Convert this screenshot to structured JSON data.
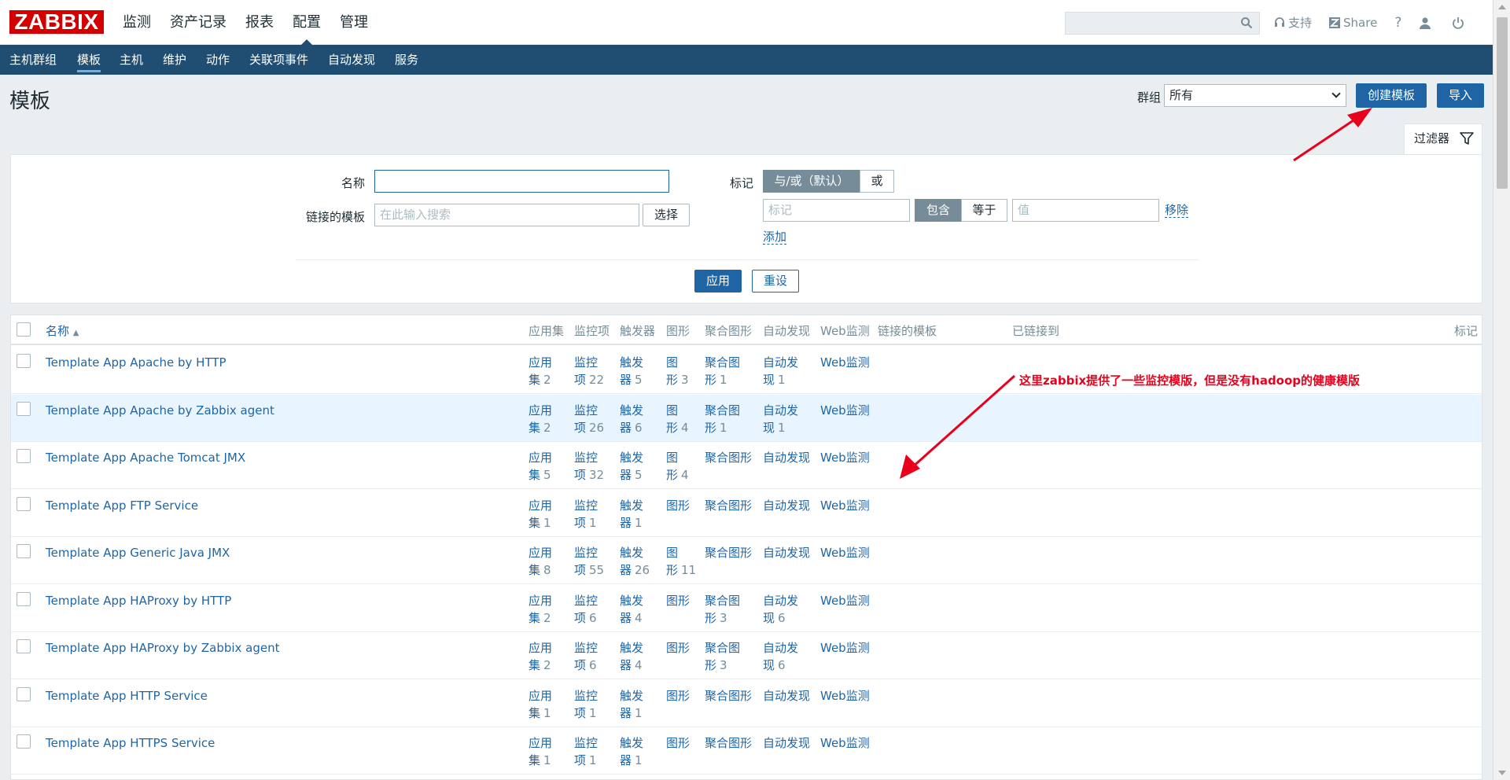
{
  "brand": {
    "logo_text": "ZABBIX",
    "accent": "#d40000",
    "nav_bg": "#1f4e72",
    "link": "#1f65a6"
  },
  "top_menu": [
    {
      "label": "监测",
      "active": false
    },
    {
      "label": "资产记录",
      "active": false
    },
    {
      "label": "报表",
      "active": false
    },
    {
      "label": "配置",
      "active": true
    },
    {
      "label": "管理",
      "active": false
    }
  ],
  "search": {
    "placeholder": "",
    "icon": "search-icon"
  },
  "top_links": {
    "support": "支持",
    "share": "Share",
    "help": "?",
    "user_icon": "user-icon",
    "logout_icon": "power-icon"
  },
  "sub_menu": [
    {
      "label": "主机群组",
      "active": false
    },
    {
      "label": "模板",
      "active": true
    },
    {
      "label": "主机",
      "active": false
    },
    {
      "label": "维护",
      "active": false
    },
    {
      "label": "动作",
      "active": false
    },
    {
      "label": "关联项事件",
      "active": false
    },
    {
      "label": "自动发现",
      "active": false
    },
    {
      "label": "服务",
      "active": false
    }
  ],
  "page": {
    "title": "模板",
    "group_label": "群组",
    "group_value": "所有",
    "create_button": "创建模板",
    "import_button": "导入",
    "filter_tab": "过滤器"
  },
  "filter": {
    "name_label": "名称",
    "name_value": "",
    "linked_label": "链接的模板",
    "linked_placeholder": "在此输入搜索",
    "select_button": "选择",
    "tags_label": "标记",
    "tag_mode_and": "与/或（默认）",
    "tag_mode_or": "或",
    "tag_placeholder": "标记",
    "op_contains": "包含",
    "op_equals": "等于",
    "value_placeholder": "值",
    "remove_link": "移除",
    "add_link": "添加",
    "apply_button": "应用",
    "reset_button": "重设"
  },
  "table": {
    "headers": {
      "name": "名称",
      "sort_arrow": "▲",
      "apps": "应用集",
      "items": "监控项",
      "triggers": "触发器",
      "graphs": "图形",
      "screens": "聚合图形",
      "discovery": "自动发现",
      "web": "Web监测",
      "linked_templates": "链接的模板",
      "linked_to": "已链接到",
      "tags": "标记"
    },
    "rows": [
      {
        "name": "Template App Apache by HTTP",
        "apps_a": "应用",
        "apps_b": "集",
        "apps_n": "2",
        "items_a": "监控",
        "items_b": "项",
        "items_n": "22",
        "trig_a": "触发",
        "trig_b": "器",
        "trig_n": "5",
        "graph_a": "图",
        "graph_b": "形",
        "graph_n": "3",
        "screen_a": "聚合图",
        "screen_b": "形",
        "screen_n": "1",
        "disc_a": "自动发",
        "disc_b": "现",
        "disc_n": "1",
        "web": "Web监测"
      },
      {
        "name": "Template App Apache by Zabbix agent",
        "apps_a": "应用",
        "apps_b": "集",
        "apps_n": "2",
        "items_a": "监控",
        "items_b": "项",
        "items_n": "26",
        "trig_a": "触发",
        "trig_b": "器",
        "trig_n": "6",
        "graph_a": "图",
        "graph_b": "形",
        "graph_n": "4",
        "screen_a": "聚合图",
        "screen_b": "形",
        "screen_n": "1",
        "disc_a": "自动发",
        "disc_b": "现",
        "disc_n": "1",
        "web": "Web监测"
      },
      {
        "name": "Template App Apache Tomcat JMX",
        "apps_a": "应用",
        "apps_b": "集",
        "apps_n": "5",
        "items_a": "监控",
        "items_b": "项",
        "items_n": "32",
        "trig_a": "触发",
        "trig_b": "器",
        "trig_n": "5",
        "graph_a": "图",
        "graph_b": "形",
        "graph_n": "4",
        "screen": "聚合图形",
        "disc": "自动发现",
        "web": "Web监测"
      },
      {
        "name": "Template App FTP Service",
        "apps_a": "应用",
        "apps_b": "集",
        "apps_n": "1",
        "items_a": "监控",
        "items_b": "项",
        "items_n": "1",
        "trig_a": "触发",
        "trig_b": "器",
        "trig_n": "1",
        "graph": "图形",
        "screen": "聚合图形",
        "disc": "自动发现",
        "web": "Web监测"
      },
      {
        "name": "Template App Generic Java JMX",
        "apps_a": "应用",
        "apps_b": "集",
        "apps_n": "8",
        "items_a": "监控",
        "items_b": "项",
        "items_n": "55",
        "trig_a": "触发",
        "trig_b": "器",
        "trig_n": "26",
        "graph_a": "图",
        "graph_b": "形",
        "graph_n": "11",
        "screen": "聚合图形",
        "disc": "自动发现",
        "web": "Web监测"
      },
      {
        "name": "Template App HAProxy by HTTP",
        "apps_a": "应用",
        "apps_b": "集",
        "apps_n": "2",
        "items_a": "监控",
        "items_b": "项",
        "items_n": "6",
        "trig_a": "触发",
        "trig_b": "器",
        "trig_n": "4",
        "graph": "图形",
        "screen_a": "聚合图",
        "screen_b": "形",
        "screen_n": "3",
        "disc_a": "自动发",
        "disc_b": "现",
        "disc_n": "6",
        "web": "Web监测"
      },
      {
        "name": "Template App HAProxy by Zabbix agent",
        "apps_a": "应用",
        "apps_b": "集",
        "apps_n": "2",
        "items_a": "监控",
        "items_b": "项",
        "items_n": "6",
        "trig_a": "触发",
        "trig_b": "器",
        "trig_n": "4",
        "graph": "图形",
        "screen_a": "聚合图",
        "screen_b": "形",
        "screen_n": "3",
        "disc_a": "自动发",
        "disc_b": "现",
        "disc_n": "6",
        "web": "Web监测"
      },
      {
        "name": "Template App HTTP Service",
        "apps_a": "应用",
        "apps_b": "集",
        "apps_n": "1",
        "items_a": "监控",
        "items_b": "项",
        "items_n": "1",
        "trig_a": "触发",
        "trig_b": "器",
        "trig_n": "1",
        "graph": "图形",
        "screen": "聚合图形",
        "disc": "自动发现",
        "web": "Web监测"
      },
      {
        "name": "Template App HTTPS Service",
        "apps_a": "应用",
        "apps_b": "集",
        "apps_n": "1",
        "items_a": "监控",
        "items_b": "项",
        "items_n": "1",
        "trig_a": "触发",
        "trig_b": "器",
        "trig_n": "1",
        "graph": "图形",
        "screen": "聚合图形",
        "disc": "自动发现",
        "web": "Web监测"
      }
    ]
  },
  "annotation": {
    "note": "这里zabbix提供了一些监控模版，但是没有hadoop的健康模版",
    "color": "#e8001c"
  }
}
